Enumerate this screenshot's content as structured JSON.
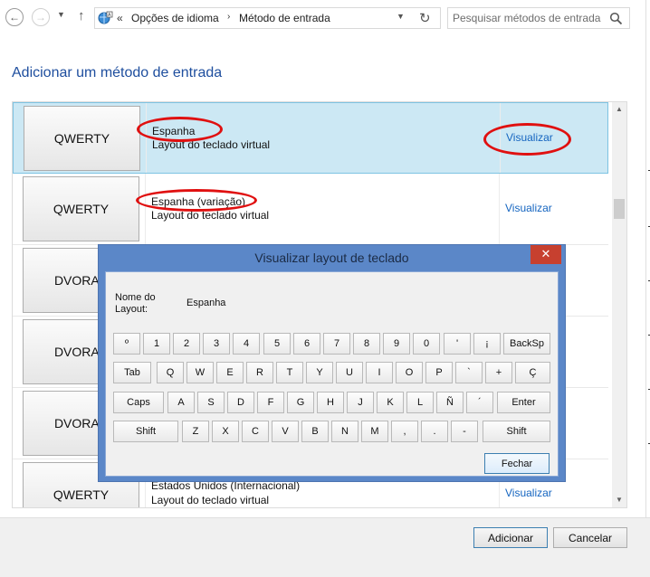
{
  "address_bar": {
    "back_icon": "arrow-left-icon",
    "forward_icon": "arrow-right-icon",
    "recent_icon": "chevron-down-icon",
    "up_icon": "arrow-up-icon",
    "location_icon": "language-icon",
    "overflow_glyph": "«",
    "crumb_sep_glyph": "›",
    "breadcrumbs": [
      "Opções de idioma",
      "Método de entrada"
    ],
    "refresh_icon": "refresh-icon",
    "search_placeholder": "Pesquisar métodos de entrada"
  },
  "page_title": "Adicionar um método de entrada",
  "list": {
    "rows": [
      {
        "thumb": "QWERTY",
        "name": "Espanha",
        "subtitle": "Layout do teclado virtual",
        "link": "Visualizar",
        "selected": true
      },
      {
        "thumb": "QWERTY",
        "name": "Espanha (variação)",
        "subtitle": "Layout do teclado virtual",
        "link": "Visualizar",
        "selected": false
      },
      {
        "thumb": "DVORAK",
        "name": "",
        "subtitle": "",
        "link": "",
        "selected": false
      },
      {
        "thumb": "DVORAK",
        "name": "",
        "subtitle": "",
        "link": "",
        "selected": false
      },
      {
        "thumb": "DVORAK",
        "name": "",
        "subtitle": "",
        "link": "",
        "selected": false
      },
      {
        "thumb": "QWERTY",
        "name": "Estados Unidos (Internacional)",
        "subtitle": "Layout do teclado virtual",
        "link": "Visualizar",
        "selected": false
      }
    ]
  },
  "dialog": {
    "title": "Visualizar layout de teclado",
    "close_glyph": "✕",
    "name_label": "Nome do Layout:",
    "name_value": "Espanha",
    "keyboard_rows": [
      [
        "º",
        "1",
        "2",
        "3",
        "4",
        "5",
        "6",
        "7",
        "8",
        "9",
        "0",
        "'",
        "¡",
        "BackSp"
      ],
      [
        "Tab",
        "Q",
        "W",
        "E",
        "R",
        "T",
        "Y",
        "U",
        "I",
        "O",
        "P",
        "`",
        "+",
        "Ç"
      ],
      [
        "Caps",
        "A",
        "S",
        "D",
        "F",
        "G",
        "H",
        "J",
        "K",
        "L",
        "Ñ",
        "´",
        "Enter"
      ],
      [
        "Shift",
        "Z",
        "X",
        "C",
        "V",
        "B",
        "N",
        "M",
        ",",
        ".",
        "-",
        "Shift"
      ]
    ],
    "close_button": "Fechar"
  },
  "buttons": {
    "add": "Adicionar",
    "cancel": "Cancelar"
  },
  "annotation_color": "#e01010"
}
